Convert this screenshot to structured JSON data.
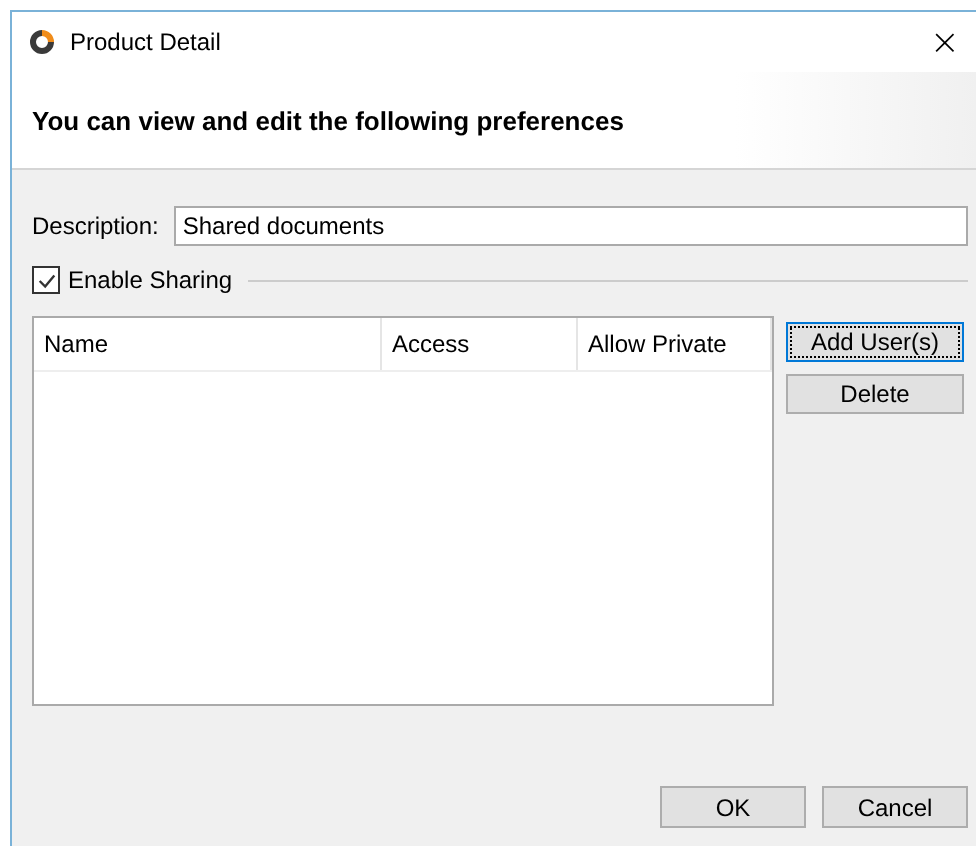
{
  "window": {
    "title": "Product Detail",
    "close": "×"
  },
  "header": "You can view and edit the following preferences",
  "description": {
    "label": "Description:",
    "value": "Shared documents"
  },
  "sharing": {
    "label": "Enable Sharing",
    "checked": true
  },
  "table": {
    "columns": [
      "Name",
      "Access",
      "Allow Private"
    ]
  },
  "side_buttons": [
    {
      "label": "Add User(s)",
      "focused": true
    },
    {
      "label": "Delete",
      "focused": false
    }
  ],
  "buttons": [
    "OK",
    "Cancel"
  ]
}
